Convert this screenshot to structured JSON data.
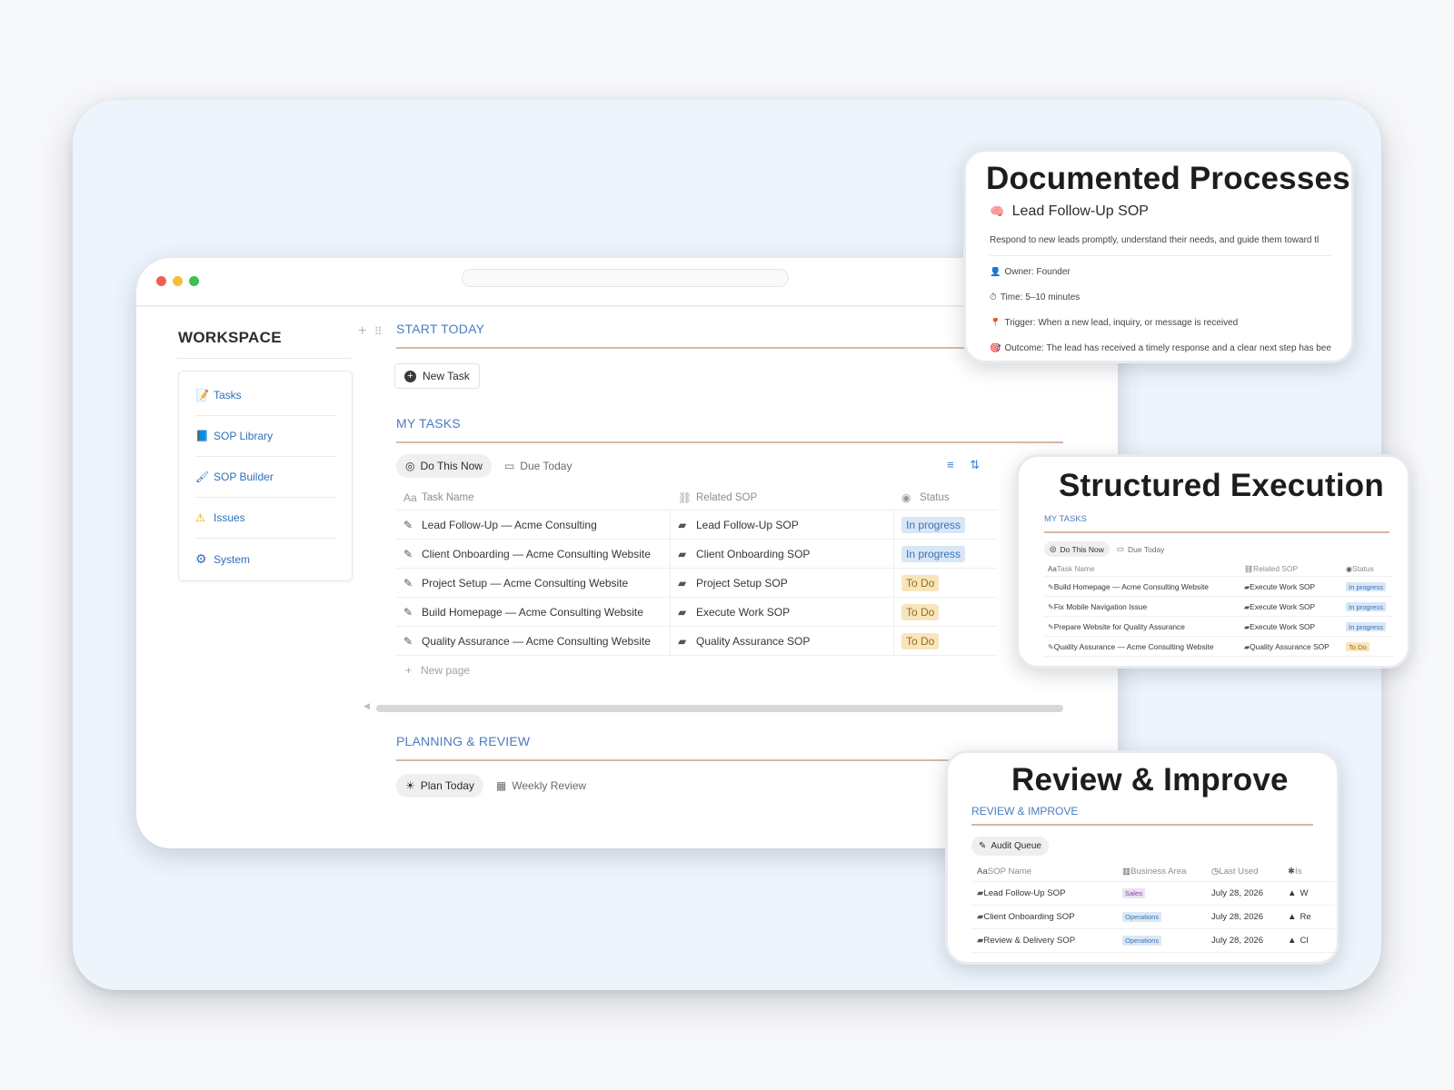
{
  "workspace": {
    "title": "WORKSPACE",
    "add_icon": "+",
    "drag_icon": "⠿",
    "menu": [
      {
        "icon": "📝",
        "icon_name": "memo-icon",
        "label": "Tasks"
      },
      {
        "icon": "📘",
        "icon_name": "book-icon",
        "label": "SOP Library"
      },
      {
        "icon": "🖌",
        "icon_name": "paintbrush-icon",
        "label": "SOP Builder"
      },
      {
        "icon": "⚠",
        "icon_name": "warning-icon",
        "label": "Issues"
      },
      {
        "icon": "⚙",
        "icon_name": "gear-icon",
        "label": "System"
      }
    ]
  },
  "start_today": {
    "title": "START TODAY",
    "new_task_label": "New Task"
  },
  "my_tasks": {
    "title": "MY TASKS",
    "tabs": [
      {
        "icon": "◎",
        "label": "Do This Now"
      },
      {
        "icon": "▭",
        "label": "Due Today"
      }
    ],
    "columns": [
      "Task Name",
      "Related SOP",
      "Status"
    ],
    "rows": [
      {
        "task": "Lead Follow-Up — Acme Consulting",
        "sop": "Lead Follow-Up SOP",
        "status": "In progress"
      },
      {
        "task": "Client Onboarding — Acme Consulting Website",
        "sop": "Client Onboarding SOP",
        "status": "In progress"
      },
      {
        "task": "Project Setup — Acme Consulting Website",
        "sop": "Project Setup SOP",
        "status": "To Do"
      },
      {
        "task": "Build Homepage — Acme Consulting Website",
        "sop": "Execute Work SOP",
        "status": "To Do"
      },
      {
        "task": "Quality Assurance — Acme Consulting Website",
        "sop": "Quality Assurance SOP",
        "status": "To Do"
      }
    ],
    "new_page_label": "New page"
  },
  "planning": {
    "title": "PLANNING & REVIEW",
    "tabs": [
      {
        "icon": "☀",
        "label": "Plan Today"
      },
      {
        "icon": "▦",
        "label": "Weekly Review"
      }
    ]
  },
  "card_docs": {
    "title": "Documented Processes",
    "sop_icon": "🧠",
    "sop_title": "Lead Follow-Up SOP",
    "description": "Respond to new leads promptly, understand their needs, and guide them toward tl",
    "fields": [
      {
        "icon": "👤",
        "text": "Owner: Founder"
      },
      {
        "icon": "⏱",
        "text": "Time: 5–10 minutes"
      },
      {
        "icon": "📍",
        "text": "Trigger: When a new lead, inquiry, or message is received"
      },
      {
        "icon": "🎯",
        "text": "Outcome: The lead has received a timely response and a clear next step has bee"
      }
    ]
  },
  "card_exec": {
    "title": "Structured Execution",
    "section": "MY TASKS",
    "tabs": [
      {
        "icon": "◎",
        "label": "Do This Now"
      },
      {
        "icon": "▭",
        "label": "Due Today"
      }
    ],
    "columns": [
      "Task Name",
      "Related SOP",
      "Status"
    ],
    "rows": [
      {
        "task": "Build Homepage — Acme Consulting Website",
        "sop": "Execute Work SOP",
        "status": "In progress"
      },
      {
        "task": "Fix Mobile Navigation Issue",
        "sop": "Execute Work SOP",
        "status": "In progress"
      },
      {
        "task": "Prepare Website for Quality Assurance",
        "sop": "Execute Work SOP",
        "status": "In progress"
      },
      {
        "task": "Quality Assurance — Acme Consulting Website",
        "sop": "Quality Assurance SOP",
        "status": "To Do"
      }
    ]
  },
  "card_review": {
    "title": "Review & Improve",
    "section": "REVIEW & IMPROVE",
    "tab_label": "Audit Queue",
    "columns": [
      "SOP Name",
      "Business Area",
      "Last Used",
      "Is"
    ],
    "rows": [
      {
        "sop": "Lead Follow-Up SOP",
        "area": "Sales",
        "last_used": "July 28, 2026",
        "issue": "W"
      },
      {
        "sop": "Client Onboarding SOP",
        "area": "Operations",
        "last_used": "July 28, 2026",
        "issue": "Re"
      },
      {
        "sop": "Review & Delivery SOP",
        "area": "Operations",
        "last_used": "July 28, 2026",
        "issue": "Cl"
      }
    ]
  },
  "colors": {
    "accent_blue": "#4a7cc0",
    "section_rule": "#d8b7a6",
    "in_progress_bg": "#d8e6f6",
    "to_do_bg": "#f7e6bc"
  }
}
